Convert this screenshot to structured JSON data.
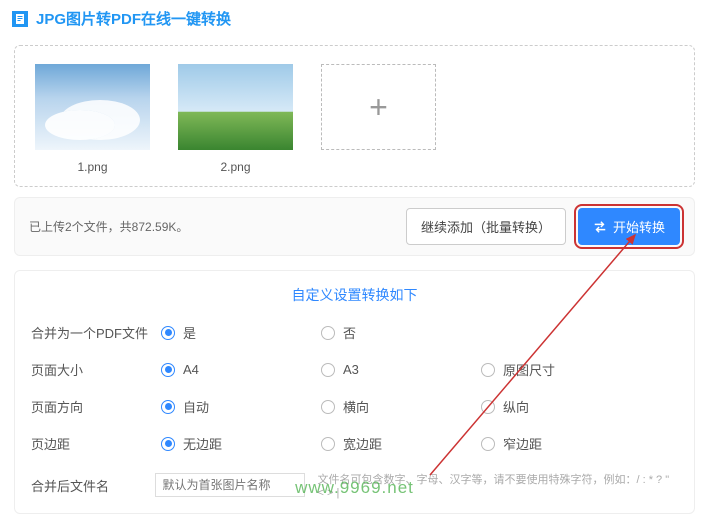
{
  "header": {
    "title": "JPG图片转PDF在线一键转换"
  },
  "thumbs": [
    {
      "name": "1.png"
    },
    {
      "name": "2.png"
    }
  ],
  "status": "已上传2个文件，共872.59K。",
  "buttons": {
    "add_more": "继续添加（批量转换）",
    "start": "开始转换"
  },
  "settings": {
    "title": "自定义设置转换如下",
    "merge": {
      "label": "合并为一个PDF文件",
      "yes": "是",
      "no": "否"
    },
    "size": {
      "label": "页面大小",
      "a4": "A4",
      "a3": "A3",
      "original": "原图尺寸"
    },
    "orient": {
      "label": "页面方向",
      "auto": "自动",
      "landscape": "横向",
      "portrait": "纵向"
    },
    "margin": {
      "label": "页边距",
      "none": "无边距",
      "wide": "宽边距",
      "narrow": "窄边距"
    },
    "filename": {
      "label": "合并后文件名",
      "placeholder": "默认为首张图片名称",
      "hint": "文件名可包含数字、字母、汉字等，请不要使用特殊字符，例如：/ : * ? \" < > |"
    }
  },
  "watermark": "www.9969.net"
}
